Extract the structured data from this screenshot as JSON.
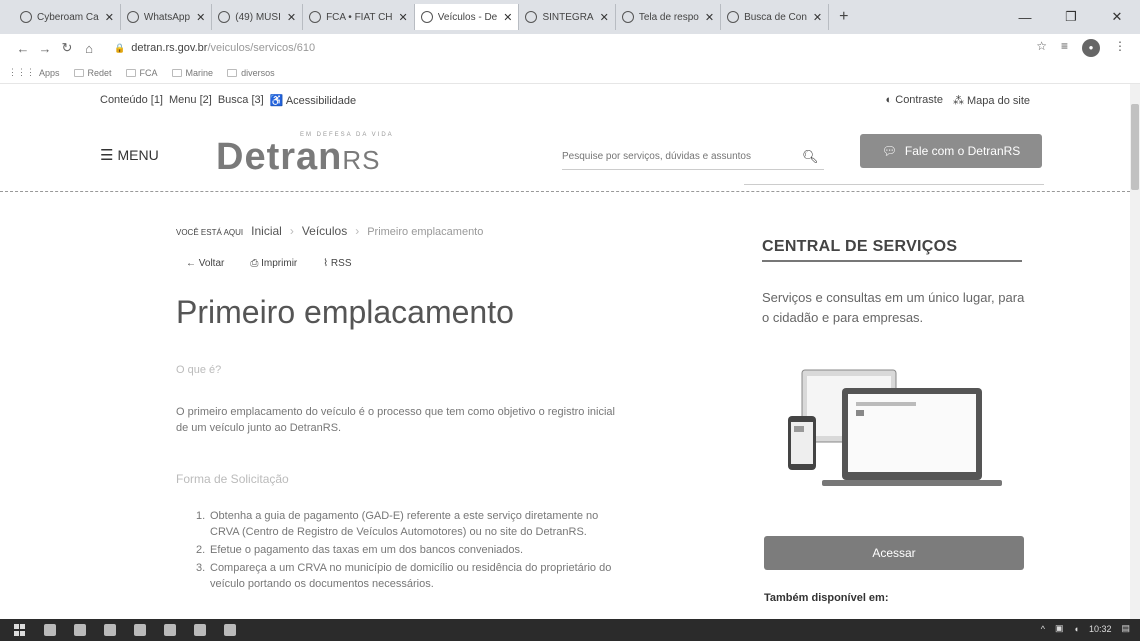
{
  "browser": {
    "tabs": [
      {
        "label": "Cyberoam Ca"
      },
      {
        "label": "WhatsApp"
      },
      {
        "label": "(49) MÚSI"
      },
      {
        "label": "FCA • FIAT CH"
      },
      {
        "label": "Veículos - De"
      },
      {
        "label": "SINTEGRA"
      },
      {
        "label": "Tela de respo"
      },
      {
        "label": "Busca de Con"
      }
    ],
    "new_tab_glyph": "+",
    "url_host": "detran.rs.gov.br",
    "url_path": "/veiculos/servicos/610",
    "bookmarks": [
      "Apps",
      "Redet",
      "FCA",
      "Marine",
      "diversos"
    ]
  },
  "accessibility": {
    "links": [
      "Conteúdo [1]",
      "Menu [2]",
      "Busca [3]",
      "Acessibilidade"
    ],
    "right_links": [
      "Contraste",
      "Mapa do site"
    ]
  },
  "header": {
    "menu_label": "MENU",
    "logo_tagline": "EM DEFESA DA VIDA",
    "logo_word": "Detran",
    "logo_suffix": "RS",
    "search_placeholder": "Pesquise por serviços, dúvidas e assuntos",
    "contact_label": "Fale com o DetranRS"
  },
  "breadcrumb": {
    "prefix": "VOCÊ ESTÁ AQUI",
    "items": [
      "Inicial",
      "Veículos",
      "Primeiro emplacamento"
    ]
  },
  "actions": {
    "back": "Voltar",
    "print": "Imprimir",
    "rss": "RSS"
  },
  "content": {
    "title": "Primeiro emplacamento",
    "what_heading": "O que é?",
    "what_text": "O primeiro emplacamento do veículo é o processo que tem como objetivo o registro inicial de um veículo junto ao DetranRS.",
    "request_heading": "Forma de Solicitação",
    "steps": [
      {
        "num": "1.",
        "text": "Obtenha a guia de pagamento (GAD-E) referente a este serviço diretamente no CRVA (Centro de Registro de Veículos Automotores) ou no site do DetranRS."
      },
      {
        "num": "2.",
        "text": "Efetue o pagamento das taxas em um dos bancos conveniados."
      },
      {
        "num": "3.",
        "text": "Compareça a um CRVA no município de domicílio ou residência do proprietário do veículo portando os documentos necessários."
      }
    ]
  },
  "sidebar": {
    "title": "CENTRAL DE SERVIÇOS",
    "description": "Serviços e consultas em um único lugar, para o cidadão e para empresas.",
    "button": "Acessar",
    "also_available": "Também disponível em:"
  },
  "taskbar": {
    "time": "10:32"
  },
  "colors": {
    "button_gray": "#7c7c7c",
    "accent_text": "#444444"
  }
}
